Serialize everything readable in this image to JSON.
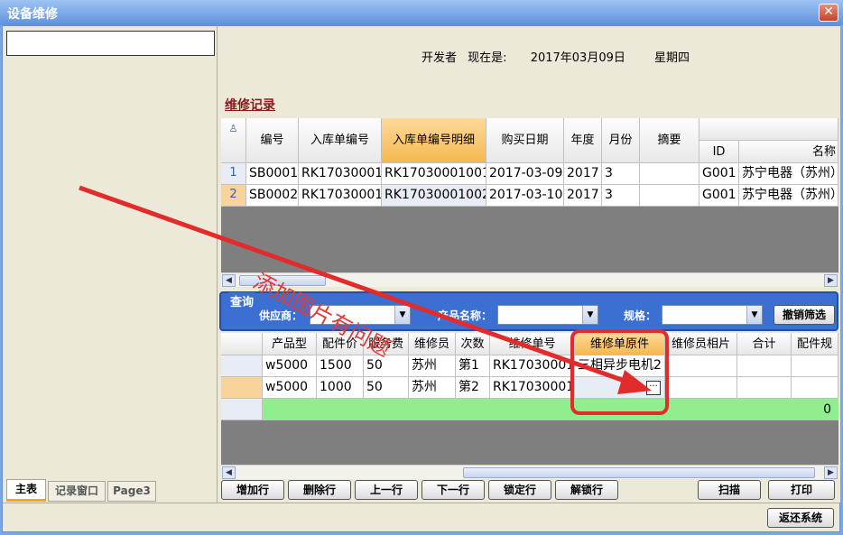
{
  "window": {
    "title": "设备维修",
    "close_glyph": "✕"
  },
  "left": {
    "search_value": "",
    "tabs": [
      "主表",
      "记录窗口",
      "Page3"
    ]
  },
  "header": {
    "developer": "开发者",
    "now_label": "现在是:",
    "date": "2017年03月09日",
    "weekday": "星期四"
  },
  "section_title": "维修记录",
  "top_grid": {
    "corner": "♙",
    "columns": [
      "编号",
      "入库单编号",
      "入库单编号明细",
      "购买日期",
      "年度",
      "月份",
      "摘要",
      "ID",
      "名称"
    ],
    "rows": [
      {
        "idx": "1",
        "cells": [
          "SB0001",
          "RK17030001",
          "RK17030001001",
          "2017-03-09",
          "2017",
          "3",
          "",
          "G001",
          "苏宁电器（苏州）"
        ]
      },
      {
        "idx": "2",
        "cells": [
          "SB0002",
          "RK17030001",
          "RK17030001002",
          "2017-03-10",
          "2017",
          "3",
          "",
          "G001",
          "苏宁电器（苏州）"
        ]
      }
    ]
  },
  "query": {
    "title": "查询",
    "supplier_label": "供应商：",
    "product_label": "产品名称：",
    "spec_label": "规格：",
    "cancel_filter": "撤销筛选"
  },
  "bottom_grid": {
    "columns": [
      "产品型",
      "配件价",
      "服务费",
      "维修员",
      "次数",
      "维修单号",
      "维修单原件",
      "维修员相片",
      "合计",
      "配件规"
    ],
    "rows": [
      {
        "cells": [
          "w5000",
          "1500",
          "50",
          "苏州",
          "第1",
          "RK17030001",
          "三相异步电机2",
          "",
          "",
          ""
        ]
      },
      {
        "cells": [
          "w5000",
          "1000",
          "50",
          "苏州",
          "第2",
          "RK17030001",
          "",
          "",
          "",
          ""
        ]
      }
    ],
    "total_value": "0",
    "ellipsis": "···"
  },
  "actions": [
    "增加行",
    "删除行",
    "上一行",
    "下一行",
    "锁定行",
    "解锁行",
    "扫描",
    "打印"
  ],
  "exit_button": "返还系统",
  "annotation_text": "添加图片有问题",
  "colors": {
    "accent_red": "#e22b2b",
    "query_blue": "#3b6fd1",
    "highlight": "#f5b84e",
    "total_row": "#90ee90"
  }
}
